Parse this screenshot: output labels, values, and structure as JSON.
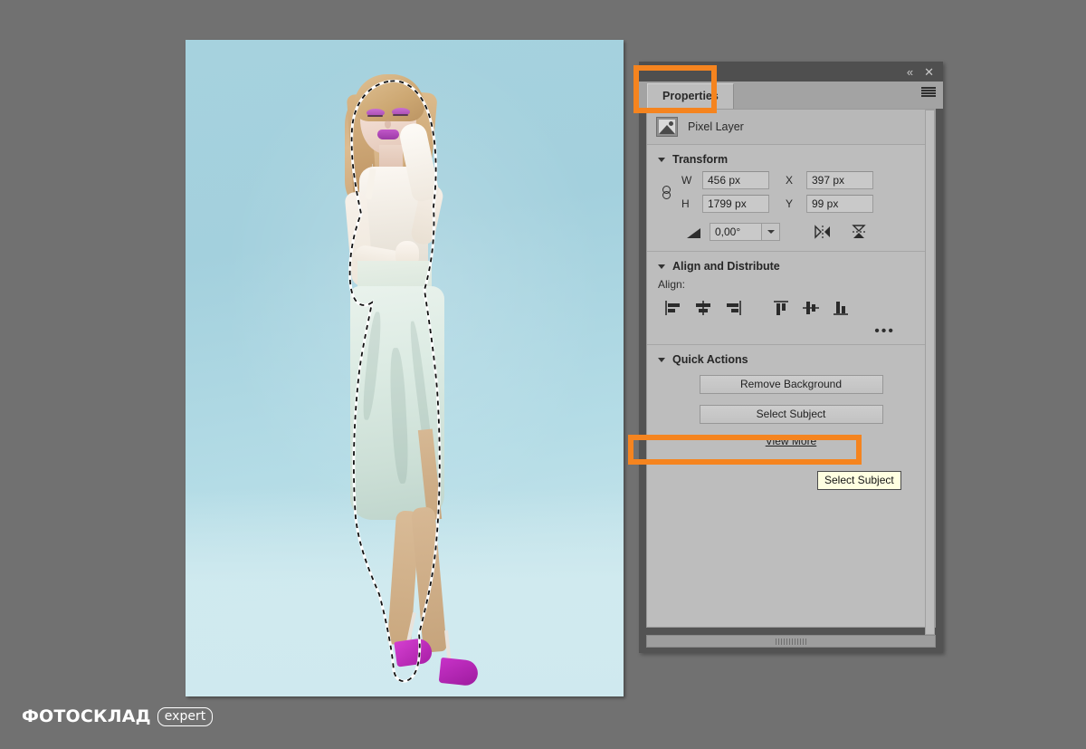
{
  "app": {
    "panel_title": "Properties",
    "accent_orange": "#F5841F"
  },
  "panel": {
    "titlebar": {
      "collapse_label": "«",
      "close_label": "✕"
    },
    "tab": {
      "label": "Properties"
    },
    "layer": {
      "name": "Pixel Layer",
      "thumb_icon": "image-thumbnail-icon"
    },
    "sections": {
      "transform": {
        "title": "Transform",
        "link_icon": "link-chain-icon",
        "fields": [
          {
            "label": "W",
            "value": "456 px"
          },
          {
            "label": "X",
            "value": "397 px"
          },
          {
            "label": "H",
            "value": "1799 px"
          },
          {
            "label": "Y",
            "value": "99 px"
          }
        ],
        "angle": {
          "icon": "angle-icon",
          "value": "0,00°"
        },
        "flip_horizontal_icon": "flip-horizontal-icon",
        "flip_vertical_icon": "flip-vertical-icon"
      },
      "align": {
        "title": "Align and Distribute",
        "align_label": "Align:",
        "buttons": [
          "align-left-icon",
          "align-center-horizontal-icon",
          "align-right-icon",
          "align-top-icon",
          "align-center-vertical-icon",
          "align-bottom-icon"
        ],
        "more_label": "•••"
      },
      "quick_actions": {
        "title": "Quick Actions",
        "remove_background_label": "Remove Background",
        "select_subject_label": "Select Subject",
        "view_more_label": "View More"
      }
    },
    "menu_icon": "hamburger-menu-icon",
    "scrollbar": "vertical-scrollbar",
    "grip": "resize-grip"
  },
  "tooltip": {
    "text": "Select Subject"
  },
  "canvas": {
    "name": "image-canvas",
    "selection": "marching-ants-selection"
  },
  "watermark": {
    "text": "ФОТОСКЛАД",
    "badge": "expert"
  }
}
